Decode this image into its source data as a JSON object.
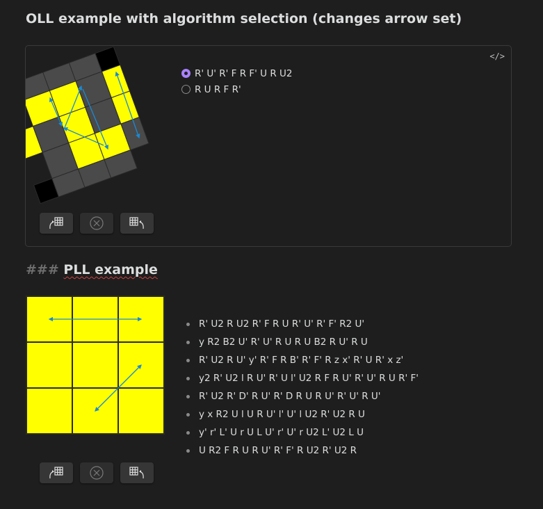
{
  "oll": {
    "title": "OLL example with algorithm selection (changes arrow set)",
    "code_icon": "</>",
    "algorithms": [
      {
        "label": "R' U' R' F R F' U R U2",
        "selected": true
      },
      {
        "label": "R U R F R'",
        "selected": false
      }
    ]
  },
  "pll": {
    "heading_marker": "###",
    "heading": "PLL example",
    "algorithms": [
      "R' U2 R U2 R' F R U R' U' R' F' R2 U'",
      "y R2 B2 U' R' U' R U R U B2 R U' R U",
      "R' U2 R U' y' R' F R B' R' F' R z x' R' U R' x z'",
      "y2 R' U2 l R U' R' U l' U2 R F R U' R' U' R U R' F'",
      "R' U2 R' D' R U' R' D R U R U' R' U' R U'",
      "y x R2 U l U R U' l' U' l U2 R' U2 R U",
      "y' r' L' U r U L U' r' U' r U2 L' U2 L U",
      "U R2 F R U R U' R' F' R U2 R' U2 R"
    ]
  },
  "colors": {
    "yellow": "#ffff00",
    "gray": "#4a4a4a",
    "black": "#000000",
    "arrow": "#1a8ad4",
    "accent": "#a882ff"
  },
  "icons": {
    "rotate_left": "rotate-left-icon",
    "reset": "reset-icon",
    "rotate_right": "rotate-right-icon"
  }
}
